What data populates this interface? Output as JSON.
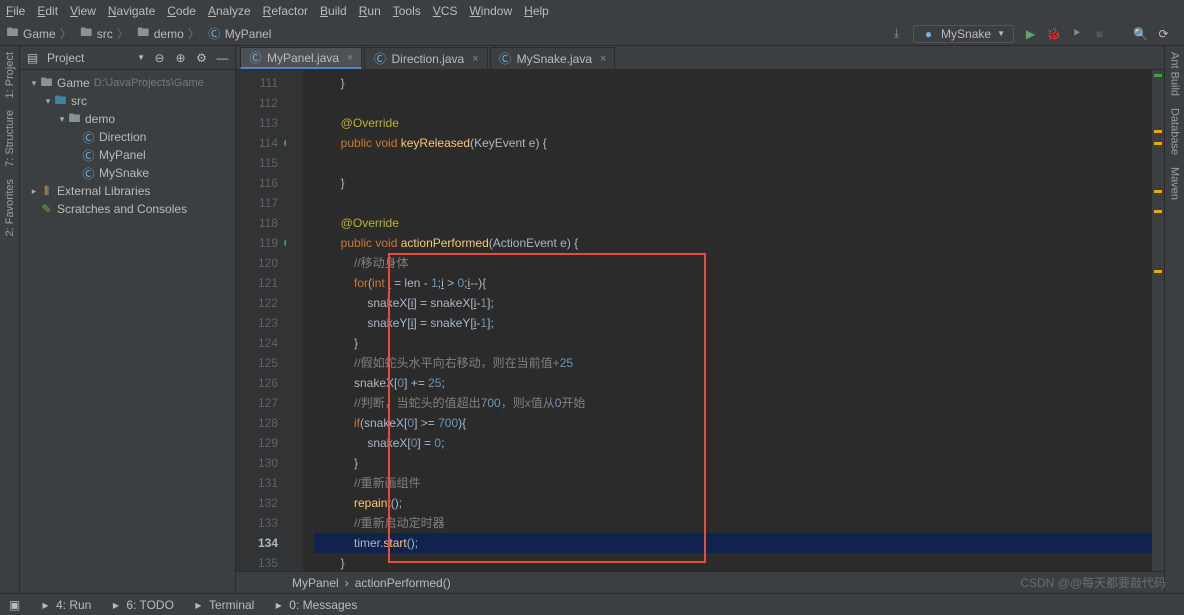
{
  "menu": [
    "File",
    "Edit",
    "View",
    "Navigate",
    "Code",
    "Analyze",
    "Refactor",
    "Build",
    "Run",
    "Tools",
    "VCS",
    "Window",
    "Help"
  ],
  "breadcrumbs": [
    {
      "icon": "folder",
      "label": "Game"
    },
    {
      "icon": "folder",
      "label": "src"
    },
    {
      "icon": "folder",
      "label": "demo"
    },
    {
      "icon": "class",
      "label": "MyPanel"
    }
  ],
  "run": {
    "config": "MySnake"
  },
  "project_pane": {
    "title": "Project",
    "tree": [
      {
        "ind": 1,
        "tw": "▾",
        "icon": "folder",
        "label": "Game",
        "path": "D:\\JavaProjects\\Game"
      },
      {
        "ind": 2,
        "tw": "▾",
        "icon": "folder-src",
        "label": "src",
        "path": ""
      },
      {
        "ind": 3,
        "tw": "▾",
        "icon": "folder",
        "label": "demo",
        "path": ""
      },
      {
        "ind": 4,
        "tw": "",
        "icon": "class",
        "label": "Direction",
        "path": ""
      },
      {
        "ind": 4,
        "tw": "",
        "icon": "class",
        "label": "MyPanel",
        "path": ""
      },
      {
        "ind": 4,
        "tw": "",
        "icon": "class",
        "label": "MySnake",
        "path": ""
      },
      {
        "ind": 1,
        "tw": "▸",
        "icon": "lib",
        "label": "External Libraries",
        "path": ""
      },
      {
        "ind": 1,
        "tw": "",
        "icon": "scratch",
        "label": "Scratches and Consoles",
        "path": ""
      }
    ]
  },
  "tabs": [
    {
      "label": "MyPanel.java",
      "active": true
    },
    {
      "label": "Direction.java",
      "active": false
    },
    {
      "label": "MySnake.java",
      "active": false
    }
  ],
  "code": {
    "start": 111,
    "current": 134,
    "override_dots": [
      114,
      119
    ],
    "lines": [
      "        }",
      "",
      "        @Override",
      "        public void keyReleased(KeyEvent e) {",
      "",
      "        }",
      "",
      "        @Override",
      "        public void actionPerformed(ActionEvent e) {",
      "            //移动身体",
      "            for(int i = len - 1;i > 0;i--){",
      "                snakeX[i] = snakeX[i-1];",
      "                snakeY[i] = snakeY[i-1];",
      "            }",
      "            //假如蛇头水平向右移动，则在当前值+25",
      "            snakeX[0] += 25;",
      "            //判断，当蛇头的值超出700，则x值从0开始",
      "            if(snakeX[0] >= 700){",
      "                snakeX[0] = 0;",
      "            }",
      "            //重新画组件",
      "            repaint();",
      "            //重新启动定时器",
      "            timer.start();",
      "        }",
      "    }"
    ]
  },
  "crumb_bottom": [
    "MyPanel",
    "actionPerformed()"
  ],
  "status": [
    {
      "icon": "run",
      "label": "4: Run"
    },
    {
      "icon": "todo",
      "label": "6: TODO"
    },
    {
      "icon": "terminal",
      "label": "Terminal"
    },
    {
      "icon": "msg",
      "label": "0: Messages"
    }
  ],
  "left_rail": [
    "1: Project",
    "7: Structure",
    "2: Favorites"
  ],
  "right_rail": [
    "Ant Build",
    "Database",
    "Maven"
  ],
  "watermark": "CSDN @@每天都要敲代码"
}
